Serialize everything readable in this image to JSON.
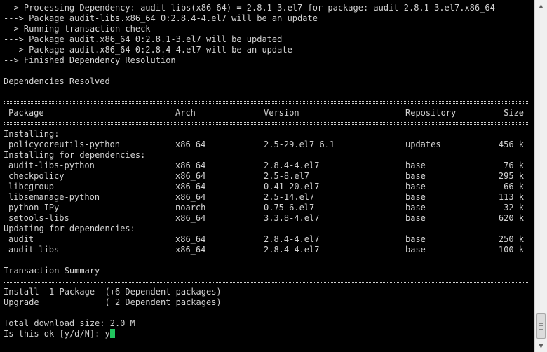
{
  "terminal": {
    "log_lines": [
      "--> Processing Dependency: audit-libs(x86-64) = 2.8.1-3.el7 for package: audit-2.8.1-3.el7.x86_64",
      "---> Package audit-libs.x86_64 0:2.8.4-4.el7 will be an update",
      "--> Running transaction check",
      "---> Package audit.x86_64 0:2.8.1-3.el7 will be updated",
      "---> Package audit.x86_64 0:2.8.4-4.el7 will be an update",
      "--> Finished Dependency Resolution"
    ],
    "resolved_text": "Dependencies Resolved",
    "table": {
      "headers": {
        "package": "Package",
        "arch": "Arch",
        "version": "Version",
        "repository": "Repository",
        "size": "Size"
      },
      "sections": [
        {
          "title": "Installing:",
          "rows": [
            {
              "package": "policycoreutils-python",
              "arch": "x86_64",
              "version": "2.5-29.el7_6.1",
              "repository": "updates",
              "size": "456 k"
            }
          ]
        },
        {
          "title": "Installing for dependencies:",
          "rows": [
            {
              "package": "audit-libs-python",
              "arch": "x86_64",
              "version": "2.8.4-4.el7",
              "repository": "base",
              "size": "76 k"
            },
            {
              "package": "checkpolicy",
              "arch": "x86_64",
              "version": "2.5-8.el7",
              "repository": "base",
              "size": "295 k"
            },
            {
              "package": "libcgroup",
              "arch": "x86_64",
              "version": "0.41-20.el7",
              "repository": "base",
              "size": "66 k"
            },
            {
              "package": "libsemanage-python",
              "arch": "x86_64",
              "version": "2.5-14.el7",
              "repository": "base",
              "size": "113 k"
            },
            {
              "package": "python-IPy",
              "arch": "noarch",
              "version": "0.75-6.el7",
              "repository": "base",
              "size": "32 k"
            },
            {
              "package": "setools-libs",
              "arch": "x86_64",
              "version": "3.3.8-4.el7",
              "repository": "base",
              "size": "620 k"
            }
          ]
        },
        {
          "title": "Updating for dependencies:",
          "rows": [
            {
              "package": "audit",
              "arch": "x86_64",
              "version": "2.8.4-4.el7",
              "repository": "base",
              "size": "250 k"
            },
            {
              "package": "audit-libs",
              "arch": "x86_64",
              "version": "2.8.4-4.el7",
              "repository": "base",
              "size": "100 k"
            }
          ]
        }
      ]
    },
    "summary": {
      "title": "Transaction Summary",
      "install_line": "Install  1 Package  (+6 Dependent packages)",
      "upgrade_line": "Upgrade             ( 2 Dependent packages)",
      "download_size": "Total download size: 2.0 M",
      "prompt": "Is this ok [y/d/N]: ",
      "input_value": "y"
    },
    "colors": {
      "background": "#000000",
      "text": "#d2d2d2",
      "cursor": "#22c55e"
    }
  },
  "scrollbar": {
    "up_icon": "triangle-up-icon",
    "down_icon": "triangle-down-icon"
  }
}
